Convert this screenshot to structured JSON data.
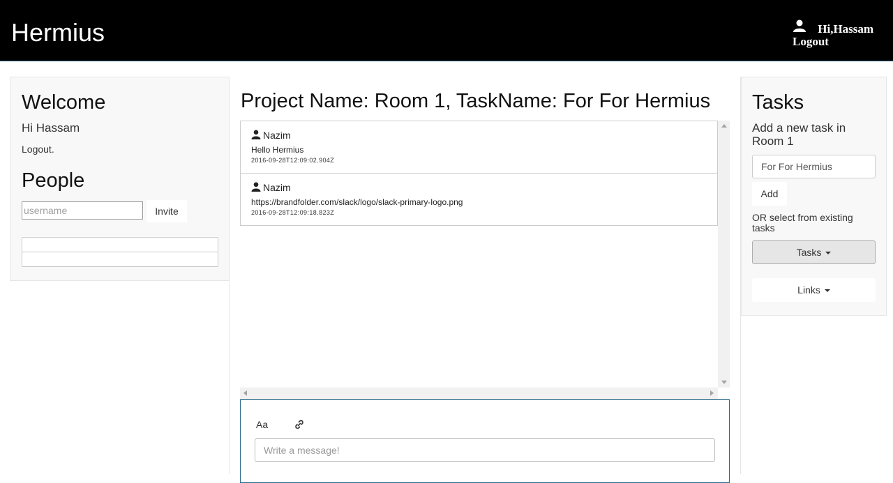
{
  "header": {
    "brand": "Hermius",
    "greeting": "Hi,Hassam",
    "logout": "Logout"
  },
  "left": {
    "welcome_title": "Welcome",
    "hi_name": "Hi Hassam",
    "logout_link": "Logout.",
    "people_title": "People",
    "username_placeholder": "username",
    "invite_label": "Invite"
  },
  "center": {
    "project_title": "Project Name: Room 1, TaskName: For For Hermius",
    "messages": [
      {
        "author": "Nazim",
        "text": "Hello Hermius",
        "time": "2016-09-28T12:09:02.904Z"
      },
      {
        "author": "Nazim",
        "text": "https://brandfolder.com/slack/logo/slack-primary-logo.png",
        "time": "2016-09-28T12:09:18.823Z"
      }
    ],
    "format_label": "Aa",
    "message_placeholder": "Write a message!"
  },
  "right": {
    "tasks_title": "Tasks",
    "add_task_label": "Add a new task in Room 1",
    "task_input_value": "For For Hermius",
    "add_label": "Add",
    "or_label": "OR select from existing tasks",
    "tasks_dropdown": "Tasks",
    "links_dropdown": "Links"
  }
}
